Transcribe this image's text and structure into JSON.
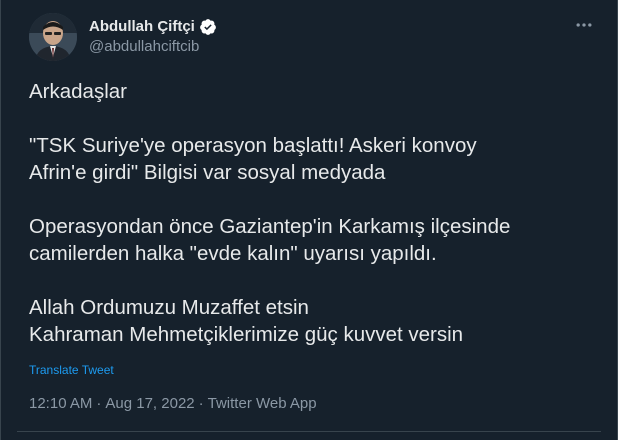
{
  "author": {
    "display_name": "Abdullah Çiftçi",
    "handle": "@abdullahciftcib",
    "verified": true
  },
  "icons": {
    "avatar": "avatar",
    "verified": "verified-badge-icon",
    "more": "more-horizontal-icon"
  },
  "colors": {
    "background": "#16212c",
    "text": "#e7e9ea",
    "muted": "#8b98a5",
    "accent": "#1d9bf0"
  },
  "tweet": {
    "paragraphs": [
      "Arkadaşlar",
      "\"TSK Suriye'ye operasyon başlattı! Askeri konvoy\nAfrin'e girdi\" Bilgisi var sosyal medyada",
      "Operasyondan önce Gaziantep'in Karkamış ilçesinde\ncamilerden halka \"evde kalın\" uyarısı yapıldı.",
      "Allah Ordumuzu Muzaffet etsin\nKahraman Mehmetçiklerimize güç kuvvet versin"
    ],
    "translate_label": "Translate Tweet",
    "time": "12:10 AM",
    "date": "Aug 17, 2022",
    "source": "Twitter Web App",
    "separator": "·"
  }
}
